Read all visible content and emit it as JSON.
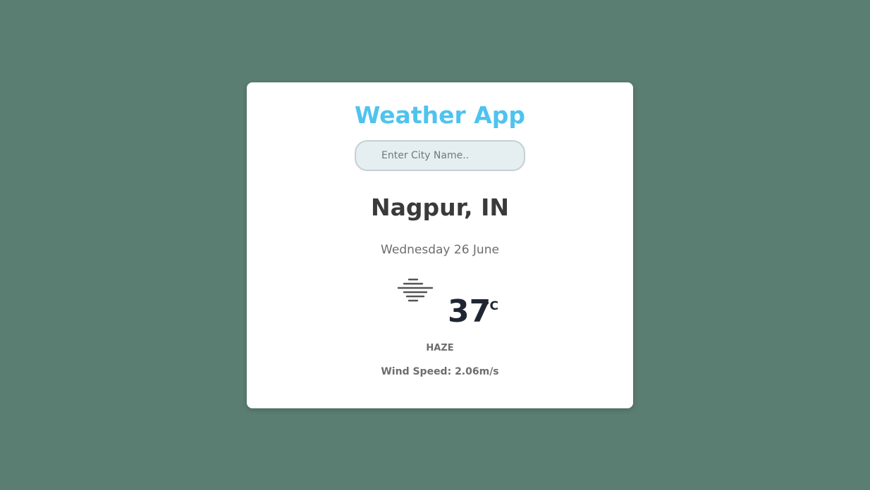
{
  "app": {
    "title": "Weather App"
  },
  "search": {
    "placeholder": "Enter City Name..",
    "value": ""
  },
  "weather": {
    "location": "Nagpur, IN",
    "date": "Wednesday 26 June",
    "icon": "haze-icon",
    "temperature": "37",
    "unit": "°C",
    "condition": "HAZE",
    "wind_label": "Wind Speed: ",
    "wind_value": "2.06m/s"
  },
  "colors": {
    "background": "#5a7e71",
    "card": "#ffffff",
    "title": "#4fc3ee",
    "text_dark": "#3a3a3a",
    "text_muted": "#6d6d6d",
    "temperature": "#1f2633",
    "icon": "#555555"
  }
}
